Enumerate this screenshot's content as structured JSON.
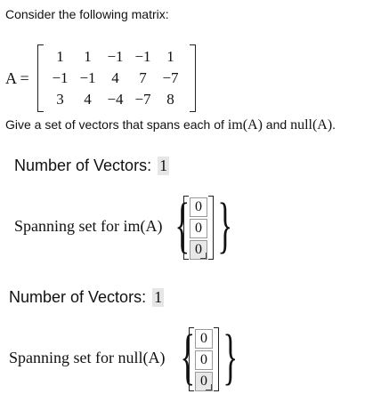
{
  "intro": "Consider the following matrix:",
  "matrix": {
    "label": "A =",
    "rows": [
      [
        "1",
        "1",
        "−1",
        "−1",
        "1"
      ],
      [
        "−1",
        "−1",
        "4",
        "7",
        "−7"
      ],
      [
        "3",
        "4",
        "−4",
        "−7",
        "8"
      ]
    ]
  },
  "question": {
    "prefix": "Give a set of vectors that spans each of ",
    "im": "im(A)",
    "mid": " and ",
    "null": "null(A)",
    "suffix": "."
  },
  "image_section": {
    "count_label": "Number of Vectors:",
    "count_value": "1",
    "span_label": "Spanning set for im(A)",
    "vector": [
      "0",
      "0",
      "0"
    ]
  },
  "null_section": {
    "count_label": "Number of Vectors:",
    "count_value": "1",
    "span_label": "Spanning set for null(A)",
    "vector": [
      "0",
      "0",
      "0"
    ]
  }
}
